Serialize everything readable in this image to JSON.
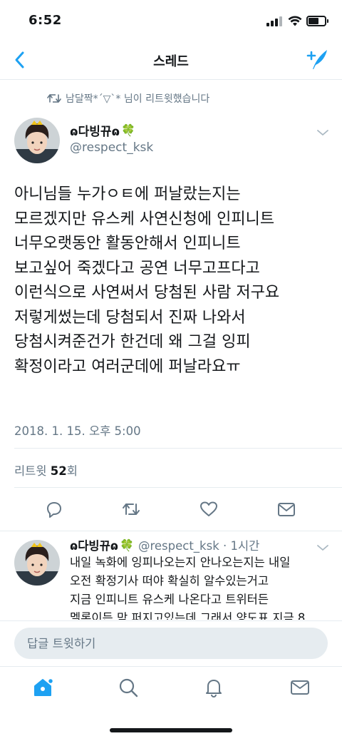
{
  "status_bar": {
    "time": "6:52"
  },
  "header": {
    "title": "스레드"
  },
  "retweet_context": {
    "text": "남달짝*´▽`* 님이 리트윗했습니다"
  },
  "main_tweet": {
    "display_name": "ɷ다빙뀨ɷ",
    "emoji": "🍀",
    "handle": "@respect_ksk",
    "text": "아니님들 누가ㅇㅌ에 퍼날랐는지는\n모르겠지만 유스케 사연신청에 인피니트\n너무오랫동안 활동안해서 인피니트\n보고싶어 죽겠다고 공연 너무고프다고\n이런식으로 사연써서 당첨된 사람 저구요\n저렇게썼는데 당첨되서 진짜 나와서\n당첨시켜준건가 한건데 왜 그걸 잉피\n확정이라고 여러군데에 퍼날라요ㅠ",
    "timestamp": "2018. 1. 15. 오후 5:00",
    "retweet_label": "리트윗",
    "retweet_count": "52",
    "retweet_unit": "회"
  },
  "reply_tweet": {
    "display_name": "ɷ다빙뀨ɷ",
    "emoji": "🍀",
    "handle_time": "@respect_ksk · 1시간",
    "text": "내일 녹화에 잉피나오는지 안나오는지는 내일\n오전 확정기사 떠야 확실히 알수있는거고\n지금 인피니트 유스케 나온다고 트위터든\n멜론이든 막 퍼지고있는데 그래서 양도표 지금 8"
  },
  "reply_bar": {
    "placeholder": "답글 트윗하기"
  },
  "colors": {
    "accent": "#1da1f2",
    "text": "#14171a",
    "muted": "#657786",
    "divider": "#e6ecf0"
  }
}
